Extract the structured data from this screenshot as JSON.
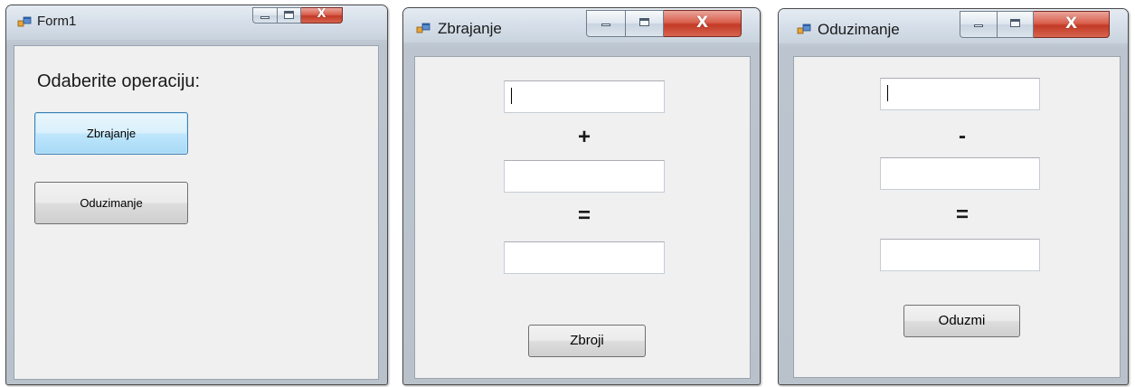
{
  "form1": {
    "title": "Form1",
    "prompt": "Odaberite operaciju:",
    "add_button": "Zbrajanje",
    "subtract_button": "Oduzimanje"
  },
  "zbrajanje": {
    "title": "Zbrajanje",
    "operator": "+",
    "equals": "=",
    "button": "Zbroji"
  },
  "oduzimanje": {
    "title": "Oduzimanje",
    "operator": "-",
    "equals": "=",
    "button": "Oduzmi"
  },
  "window_buttons": {
    "close_glyph": "X"
  },
  "colors": {
    "client_background": "#f0f0f0",
    "close_button": "#c23a26",
    "focused_button_border": "#3c7fb1"
  },
  "icons": [
    "form-icon",
    "minimize-icon",
    "maximize-icon",
    "close-icon"
  ]
}
